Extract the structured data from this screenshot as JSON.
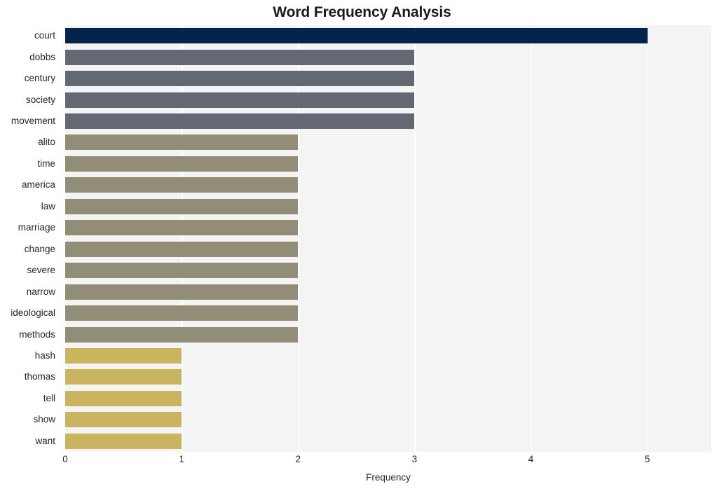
{
  "chart_data": {
    "type": "bar",
    "orientation": "horizontal",
    "title": "Word Frequency Analysis",
    "xlabel": "Frequency",
    "ylabel": "",
    "categories": [
      "court",
      "dobbs",
      "century",
      "society",
      "movement",
      "alito",
      "time",
      "america",
      "law",
      "marriage",
      "change",
      "severe",
      "narrow",
      "ideological",
      "methods",
      "hash",
      "thomas",
      "tell",
      "show",
      "want"
    ],
    "values": [
      5,
      3,
      3,
      3,
      3,
      2,
      2,
      2,
      2,
      2,
      2,
      2,
      2,
      2,
      2,
      1,
      1,
      1,
      1,
      1
    ],
    "bar_colors": [
      "#04244e",
      "#646873",
      "#646873",
      "#646873",
      "#646873",
      "#918d76",
      "#918d76",
      "#918d76",
      "#918d76",
      "#918d76",
      "#918d76",
      "#918d76",
      "#918d76",
      "#918d76",
      "#918d76",
      "#cbb45f",
      "#cbb45f",
      "#cbb45f",
      "#cbb45f",
      "#cbb45f"
    ],
    "xlim": [
      0,
      5.55
    ],
    "xticks": [
      0,
      1,
      2,
      3,
      4,
      5
    ],
    "xtick_labels": [
      "0",
      "1",
      "2",
      "3",
      "4",
      "5"
    ],
    "grid": true,
    "grid_axis": "x",
    "grid_color": "#ffffff",
    "plot_background": "#f4f4f5",
    "figure_background": "#ffffff",
    "legend": null
  }
}
